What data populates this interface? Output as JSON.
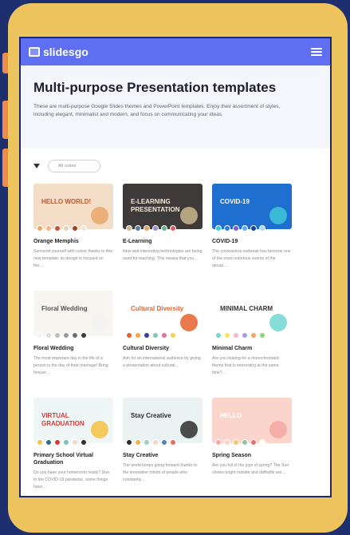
{
  "navbar": {
    "brand": "slidesgo"
  },
  "hero": {
    "title": "Multi-purpose Presentation templates",
    "description": "These are multi-purpose Google Slides themes and PowerPoint templates. Enjoy their assortment of styles, including elegant, minimalist and modern, and focus on communicating your ideas."
  },
  "filters": {
    "color_filter_label": "All colors"
  },
  "templates": [
    {
      "title": "Orange Memphis",
      "description": "Surround yourself with colors thanks to this new template; its design is focused on the…",
      "thumb_text": "HELLO WORLD!",
      "thumb_bg": "#f4ddc7",
      "thumb_color": "#b65a33",
      "palette": [
        "#e8a86a",
        "#f2b68d",
        "#c9513a",
        "#e6d2b8",
        "#a04028",
        "#f5e6d3"
      ]
    },
    {
      "title": "E-Learning",
      "description": "New and interesting technologies are being used for teaching. This means that you…",
      "thumb_text": "E-LEARNING PRESENTATION",
      "thumb_bg": "#3f3a3a",
      "thumb_color": "#f3ead8",
      "palette": [
        "#c8b88f",
        "#5f7d9c",
        "#e0a15a",
        "#9b8fd1",
        "#6ab08e",
        "#d65f5f"
      ]
    },
    {
      "title": "COVID-19",
      "description": "The coronavirus outbreak has become one of the most notorious events of the decad…",
      "thumb_text": "COVID-19",
      "thumb_bg": "#1f6fd0",
      "thumb_color": "#ffffff",
      "palette": [
        "#3ec7d6",
        "#2e7ddb",
        "#7a5cd6",
        "#5ab0f0",
        "#1a3e9a",
        "#a7d8ff"
      ]
    },
    {
      "title": "Floral Wedding",
      "description": "The most important day in the life of a person is the day of their marriage! Bring forever…",
      "thumb_text": "Floral Wedding",
      "thumb_bg": "#f7f5f0",
      "thumb_color": "#555555",
      "palette": [
        "#f2f2f2",
        "#dcdcdc",
        "#bdbdbd",
        "#999999",
        "#6e6e6e",
        "#3d3d3d"
      ]
    },
    {
      "title": "Cultural Diversity",
      "description": "Aim for an international audience by giving a presentation about cultural…",
      "thumb_text": "Cultural Diversity",
      "thumb_bg": "#ffffff",
      "thumb_color": "#e8612d",
      "palette": [
        "#e8612d",
        "#f4a640",
        "#3a3f9e",
        "#7fc8b6",
        "#e86fa3",
        "#f7d15c"
      ]
    },
    {
      "title": "Minimal Charm",
      "description": "Are you looking for a monochromatic theme that is interesting at the same time?…",
      "thumb_text": "MINIMAL CHARM",
      "thumb_bg": "#ffffff",
      "thumb_color": "#333333",
      "palette": [
        "#6fd8d0",
        "#f5e65c",
        "#f5b8d0",
        "#a99de0",
        "#f7a25d",
        "#8fd47c"
      ]
    },
    {
      "title": "Primary School Virtual Graduation",
      "description": "Do you have your homeroom ready? Due to the COVID-19 pandemic, some things have…",
      "thumb_text": "VIRTUAL GRADUATION",
      "thumb_bg": "#eef7f6",
      "thumb_color": "#d43a3a",
      "palette": [
        "#f5c243",
        "#2e6f8e",
        "#d43a3a",
        "#7cc3b6",
        "#f7d7c4",
        "#2e2e2e"
      ]
    },
    {
      "title": "Stay Creative",
      "description": "The world keeps going forward thanks to the innovative minds of people who constantly…",
      "thumb_text": "Stay Creative",
      "thumb_bg": "#eaf3f1",
      "thumb_color": "#2e2e2e",
      "palette": [
        "#2e2e2e",
        "#f3b445",
        "#9ad1c2",
        "#f3d9cc",
        "#5a7fb5",
        "#e56c5c"
      ]
    },
    {
      "title": "Spring Season",
      "description": "Are you full of the joys of spring? The Sun shines bright outside and daffodils are…",
      "thumb_text": "HELLO",
      "thumb_bg": "#fbd5cc",
      "thumb_color": "#ffffff",
      "palette": [
        "#f5a8a0",
        "#f8d3c7",
        "#f5c56a",
        "#8fc6a1",
        "#e76f6f",
        "#ffffff"
      ]
    }
  ]
}
